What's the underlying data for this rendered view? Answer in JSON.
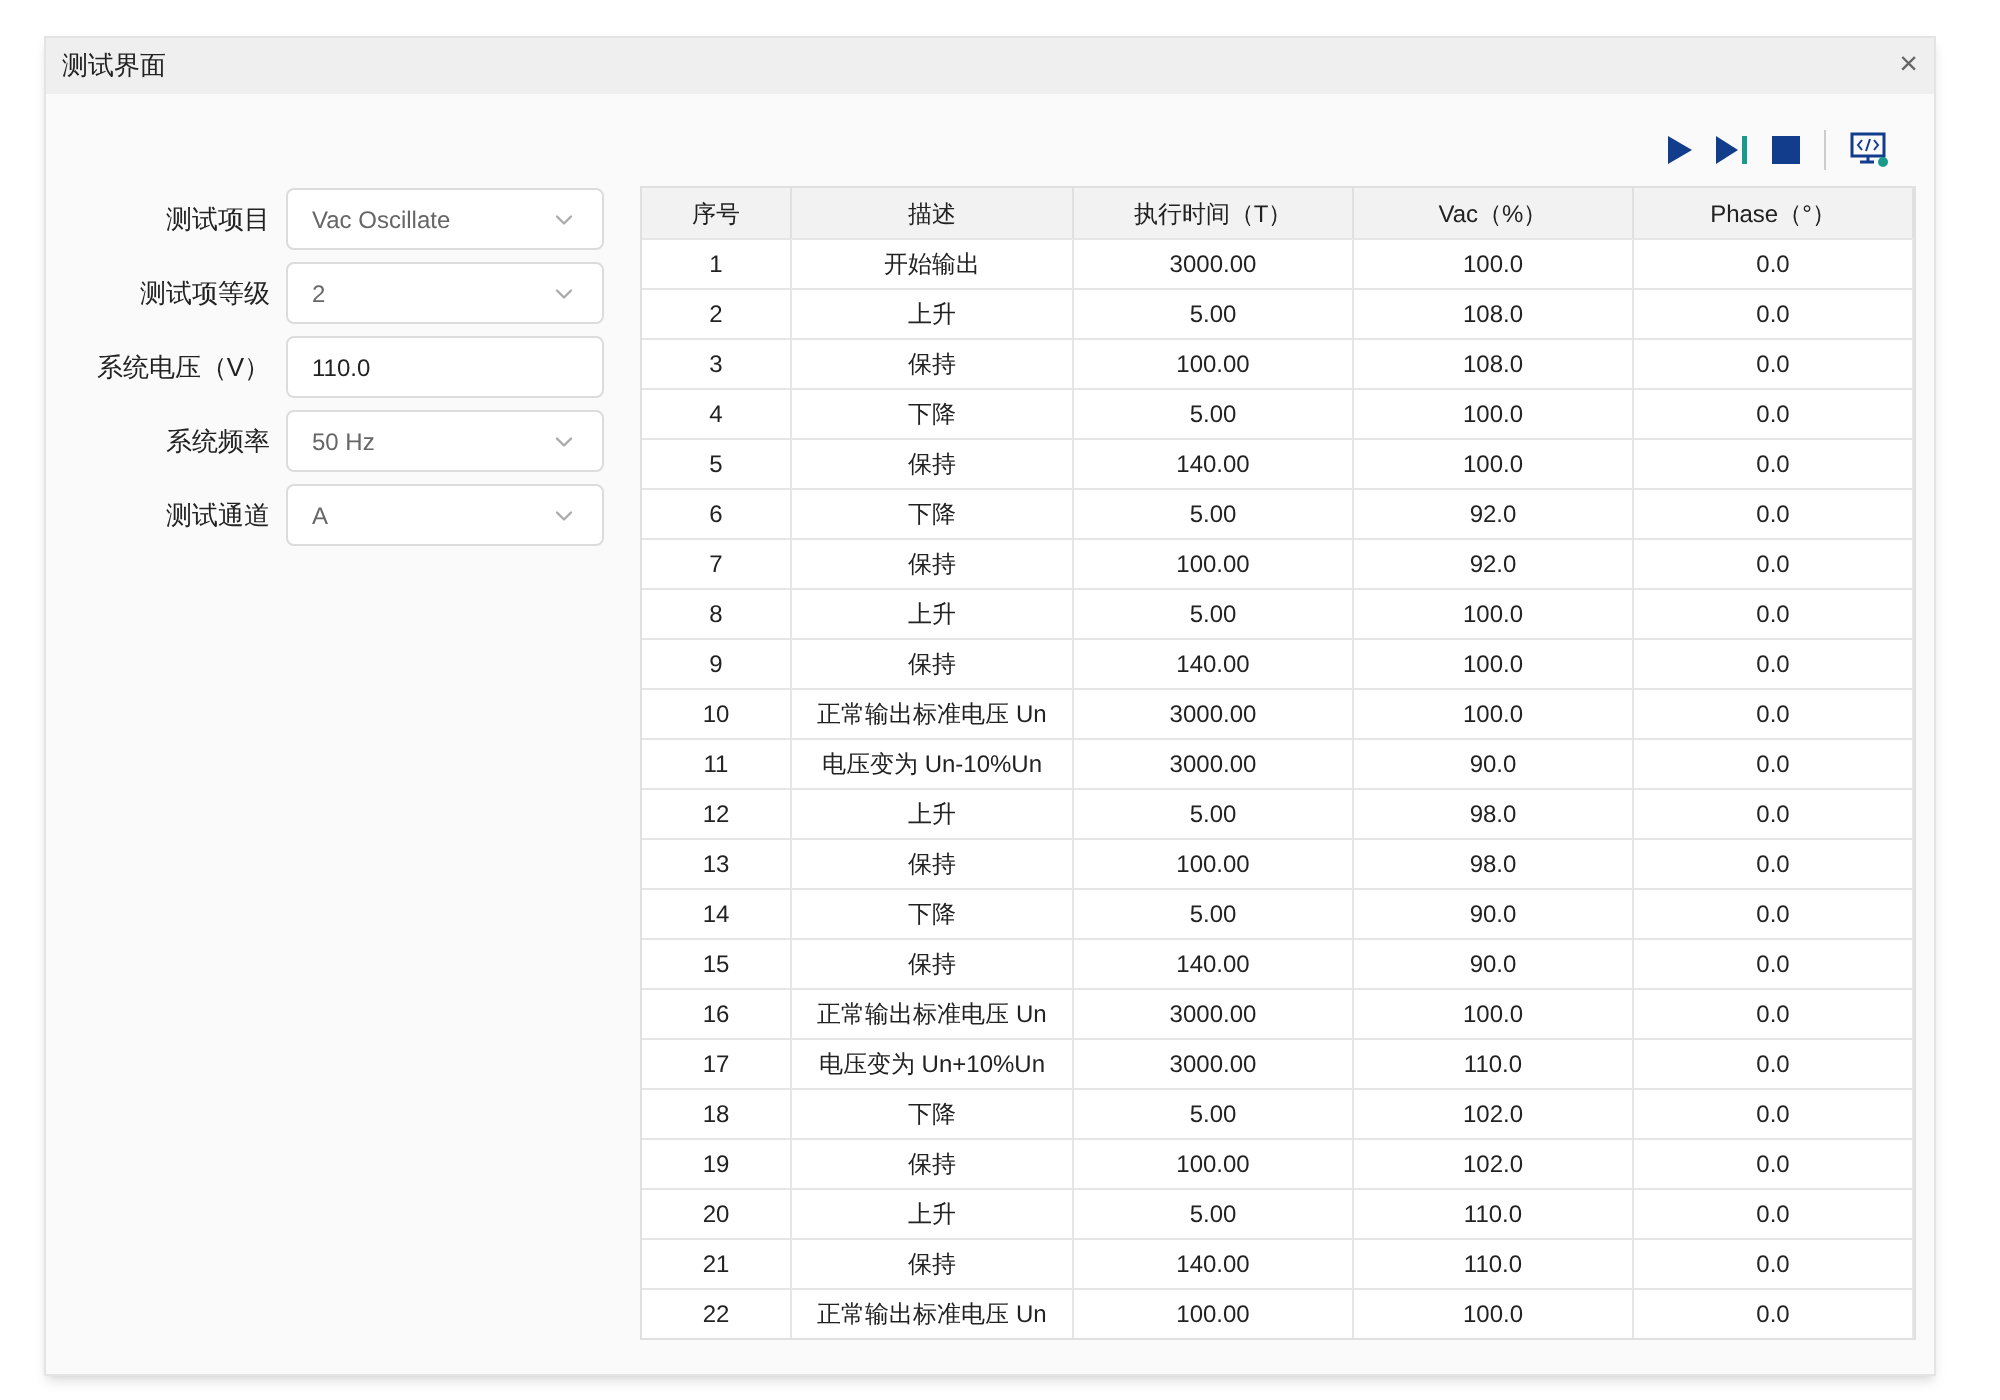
{
  "window": {
    "title": "测试界面",
    "close": "×"
  },
  "form": [
    {
      "label": "测试项目",
      "kind": "dropdown",
      "value": "Vac Oscillate"
    },
    {
      "label": "测试项等级",
      "kind": "dropdown",
      "value": "2"
    },
    {
      "label": "系统电压（V）",
      "kind": "input",
      "value": "110.0"
    },
    {
      "label": "系统频率",
      "kind": "dropdown",
      "value": "50 Hz"
    },
    {
      "label": "测试通道",
      "kind": "dropdown",
      "value": "A"
    }
  ],
  "table": {
    "columns": [
      "序号",
      "描述",
      "执行时间（T）",
      "Vac（%）",
      "Phase（°）"
    ],
    "rows": [
      [
        "1",
        "开始输出",
        "3000.00",
        "100.0",
        "0.0"
      ],
      [
        "2",
        "上升",
        "5.00",
        "108.0",
        "0.0"
      ],
      [
        "3",
        "保持",
        "100.00",
        "108.0",
        "0.0"
      ],
      [
        "4",
        "下降",
        "5.00",
        "100.0",
        "0.0"
      ],
      [
        "5",
        "保持",
        "140.00",
        "100.0",
        "0.0"
      ],
      [
        "6",
        "下降",
        "5.00",
        "92.0",
        "0.0"
      ],
      [
        "7",
        "保持",
        "100.00",
        "92.0",
        "0.0"
      ],
      [
        "8",
        "上升",
        "5.00",
        "100.0",
        "0.0"
      ],
      [
        "9",
        "保持",
        "140.00",
        "100.0",
        "0.0"
      ],
      [
        "10",
        "正常输出标准电压 Un",
        "3000.00",
        "100.0",
        "0.0"
      ],
      [
        "11",
        "电压变为 Un-10%Un",
        "3000.00",
        "90.0",
        "0.0"
      ],
      [
        "12",
        "上升",
        "5.00",
        "98.0",
        "0.0"
      ],
      [
        "13",
        "保持",
        "100.00",
        "98.0",
        "0.0"
      ],
      [
        "14",
        "下降",
        "5.00",
        "90.0",
        "0.0"
      ],
      [
        "15",
        "保持",
        "140.00",
        "90.0",
        "0.0"
      ],
      [
        "16",
        "正常输出标准电压 Un",
        "3000.00",
        "100.0",
        "0.0"
      ],
      [
        "17",
        "电压变为 Un+10%Un",
        "3000.00",
        "110.0",
        "0.0"
      ],
      [
        "18",
        "下降",
        "5.00",
        "102.0",
        "0.0"
      ],
      [
        "19",
        "保持",
        "100.00",
        "102.0",
        "0.0"
      ],
      [
        "20",
        "上升",
        "5.00",
        "110.0",
        "0.0"
      ],
      [
        "21",
        "保持",
        "140.00",
        "110.0",
        "0.0"
      ],
      [
        "22",
        "正常输出标准电压 Un",
        "100.00",
        "100.0",
        "0.0"
      ]
    ]
  }
}
